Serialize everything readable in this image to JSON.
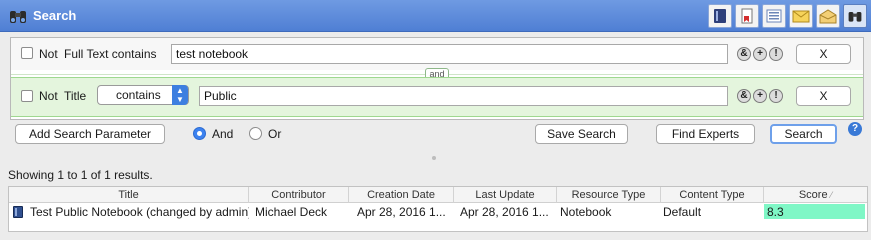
{
  "window": {
    "title": "Search"
  },
  "toolbar": {
    "icons": [
      "notebook-icon",
      "bookmark-document-icon",
      "list-icon",
      "mail-icon",
      "open-mail-icon",
      "binoculars-icon"
    ]
  },
  "criteria": {
    "row1": {
      "not_label": "Not",
      "field_label": "Full Text contains",
      "value": "test notebook",
      "remove_label": "X"
    },
    "connector": "and",
    "row2": {
      "not_label": "Not",
      "field_label": "Title",
      "operator": "contains",
      "value": "Public",
      "remove_label": "X"
    },
    "circle_buttons": {
      "and_symbol": "&",
      "add_symbol": "+",
      "not_symbol": "!"
    }
  },
  "actions": {
    "add_param": "Add Search Parameter",
    "and_label": "And",
    "or_label": "Or",
    "save_search": "Save Search",
    "find_experts": "Find Experts",
    "search": "Search",
    "help": "?"
  },
  "results": {
    "summary": "Showing 1 to 1 of 1 results.",
    "columns": [
      "Title",
      "Contributor",
      "Creation Date",
      "Last Update",
      "Resource Type",
      "Content Type",
      "Score"
    ],
    "sort_indicator": "⁄",
    "rows": [
      {
        "title": "Test Public Notebook (changed by admin)",
        "contributor": "Michael Deck",
        "creation_date": "Apr 28, 2016 1...",
        "last_update": "Apr 28, 2016 1...",
        "resource_type": "Notebook",
        "content_type": "Default",
        "score": "8.3"
      }
    ]
  },
  "colors": {
    "titlebar": "#5b87d9",
    "highlight_row": "#e4f5dd",
    "score_bar": "#7ff7c6",
    "accent": "#3c82f0"
  }
}
